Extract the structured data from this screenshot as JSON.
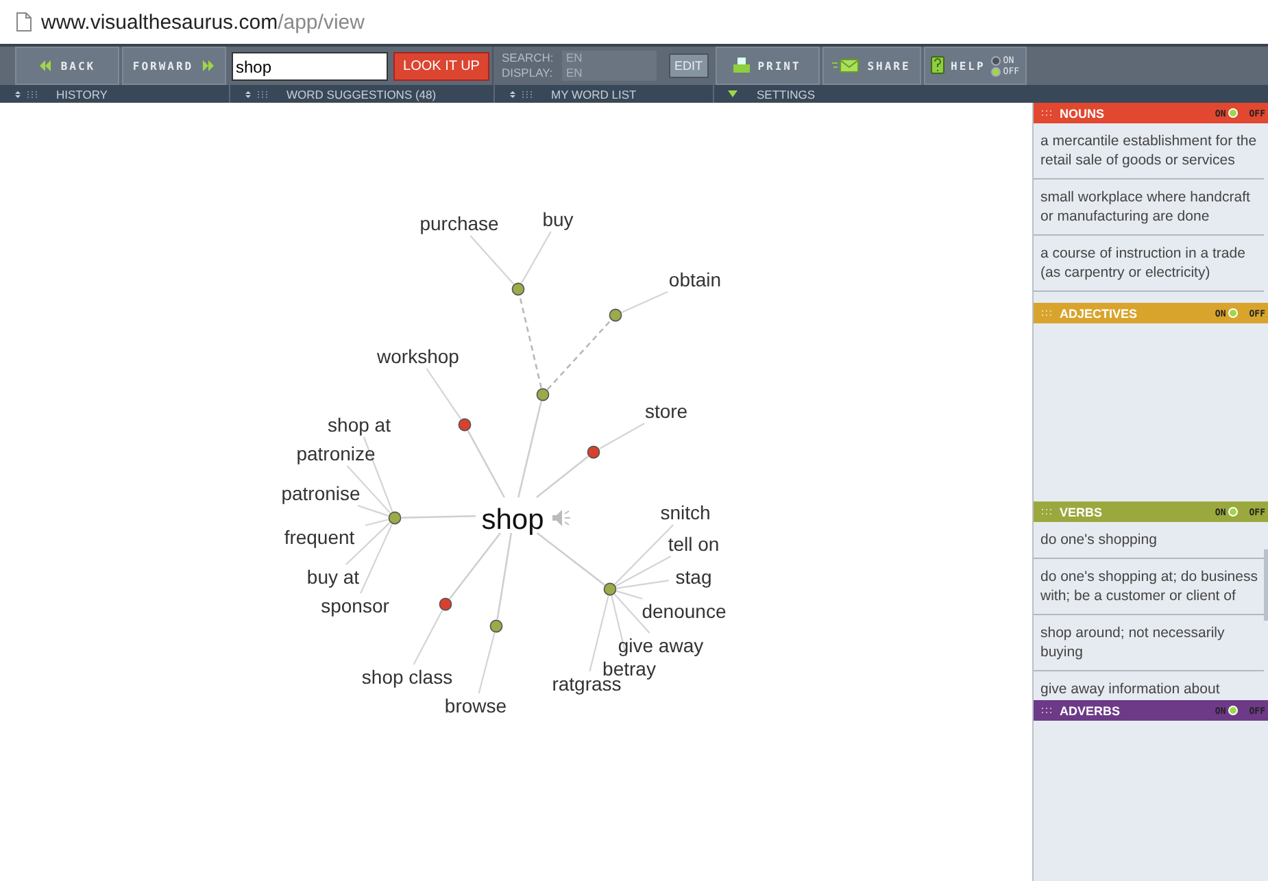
{
  "address_bar": {
    "url_host": "www.visualthesaurus.com",
    "url_path": "/app/view"
  },
  "toolbar": {
    "back": "BACK",
    "forward": "FORWARD",
    "search_value": "shop",
    "look_up": "LOOK IT UP",
    "search_label": "SEARCH:",
    "search_lang": "EN",
    "display_label": "DISPLAY:",
    "display_lang": "EN",
    "edit": "EDIT",
    "print": "PRINT",
    "share": "SHARE",
    "help": "HELP",
    "help_mode": [
      {
        "label": "ON",
        "selected": false
      },
      {
        "label": "OFF",
        "selected": true
      }
    ]
  },
  "subbar": [
    {
      "label": "HISTORY",
      "kind": "panel"
    },
    {
      "label": "WORD SUGGESTIONS (48)",
      "kind": "panel"
    },
    {
      "label": "MY WORD LIST",
      "kind": "panel"
    },
    {
      "label": "SETTINGS",
      "kind": "menu"
    }
  ],
  "graph": {
    "headword": "shop",
    "nodes": [
      {
        "color": "#9aab4a",
        "children": [
          {
            "color": "#9aab4a",
            "dashed": true,
            "words": [
              "purchase",
              "buy"
            ]
          },
          {
            "color": "#9aab4a",
            "dashed": true,
            "words": [
              "obtain"
            ]
          }
        ]
      },
      {
        "color": "#d9412e",
        "words": [
          "workshop"
        ]
      },
      {
        "color": "#d9412e",
        "words": [
          "store"
        ]
      },
      {
        "color": "#9aab4a",
        "words": [
          "shop at",
          "patronize",
          "patronise",
          "frequent",
          "buy at",
          "sponsor"
        ]
      },
      {
        "color": "#9aab4a",
        "words": [
          "snitch",
          "tell on",
          "stag",
          "denounce",
          "give away",
          "betray",
          "ratgrass"
        ]
      },
      {
        "color": "#9aab4a",
        "words": [
          "browse"
        ]
      },
      {
        "color": "#d9412e",
        "words": [
          "shop class"
        ]
      }
    ]
  },
  "sections": [
    {
      "title": "NOUNS",
      "color": "#e2472f",
      "on": true,
      "on_label": "ON",
      "off_label": "OFF",
      "items": [
        "a mercantile establishment for the retail sale of goods or services",
        "small workplace where handcraft or manufacturing are done",
        "a course of instruction in a trade (as carpentry or electricity)"
      ]
    },
    {
      "title": "ADJECTIVES",
      "color": "#d8a42c",
      "on": true,
      "on_label": "ON",
      "off_label": "OFF"
    },
    {
      "title": "VERBS",
      "color": "#9aa83e",
      "on": true,
      "on_label": "ON",
      "off_label": "OFF",
      "items": [
        "do one's shopping",
        "do one's shopping at; do business with; be a customer or client of",
        "shop around; not necessarily buying",
        "give away information about"
      ]
    },
    {
      "title": "ADVERBS",
      "color": "#6c3a86",
      "on": true,
      "on_label": "ON",
      "off_label": "OFF"
    }
  ]
}
